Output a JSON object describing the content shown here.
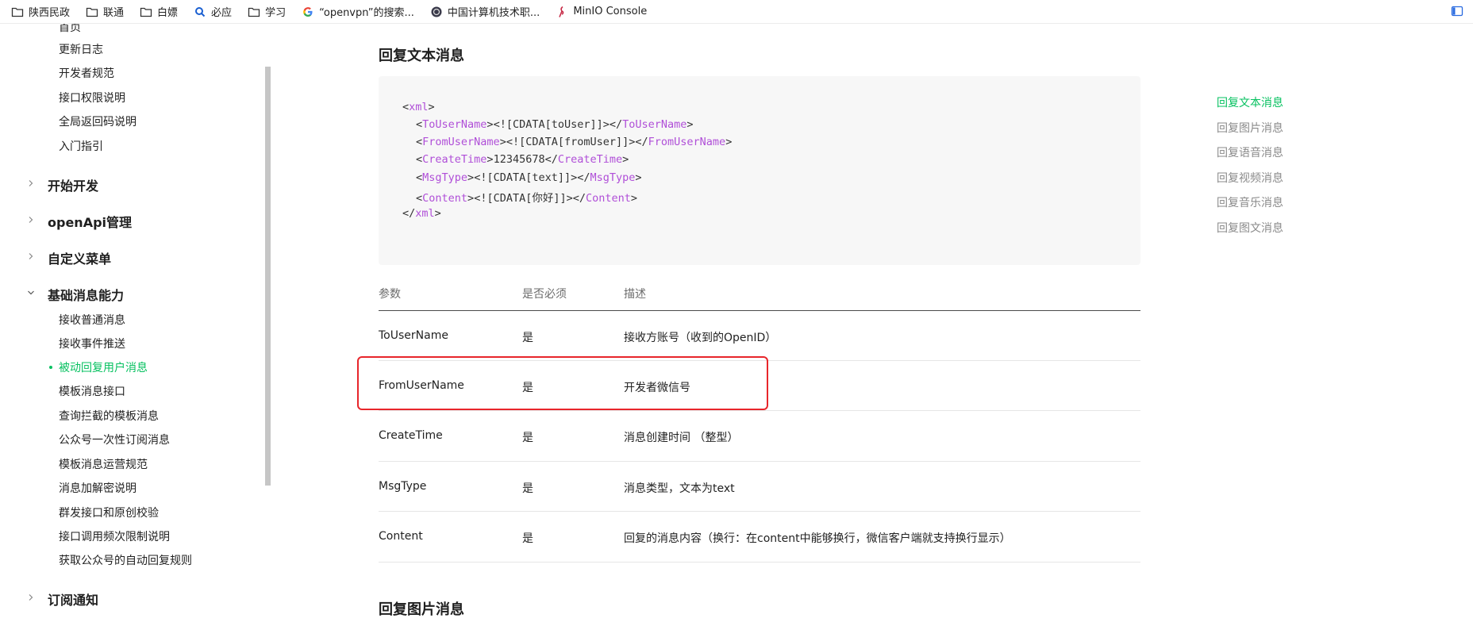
{
  "bookmarks": [
    {
      "label": "陕西民政",
      "icon": "folder-icon"
    },
    {
      "label": "联通",
      "icon": "folder-icon"
    },
    {
      "label": "白嫖",
      "icon": "folder-icon"
    },
    {
      "label": "必应",
      "icon": "search-icon"
    },
    {
      "label": "学习",
      "icon": "folder-icon"
    },
    {
      "label": "“openvpn”的搜索...",
      "icon": "google-icon"
    },
    {
      "label": "中国计算机技术职...",
      "icon": "site-icon"
    },
    {
      "label": "MinIO Console",
      "icon": "minio-icon"
    }
  ],
  "sidebar": {
    "top_items": [
      "首页",
      "更新日志",
      "开发者规范",
      "接口权限说明",
      "全局返回码说明",
      "入门指引"
    ],
    "groups": [
      "开始开发",
      "openApi管理",
      "自定义菜单",
      "基础消息能力",
      "订阅通知"
    ],
    "basic_items": [
      "接收普通消息",
      "接收事件推送",
      "被动回复用户消息",
      "模板消息接口",
      "查询拦截的模板消息",
      "公众号一次性订阅消息",
      "模板消息运营规范",
      "消息加解密说明",
      "群发接口和原创校验",
      "接口调用频次限制说明",
      "获取公众号的自动回复规则"
    ],
    "active_item": "被动回复用户消息"
  },
  "main": {
    "section_title": "回复文本消息",
    "next_section_title": "回复图片消息",
    "code": {
      "open_xml": "xml",
      "lines": [
        {
          "tag": "ToUserName",
          "value": "<![CDATA[toUser]]>"
        },
        {
          "tag": "FromUserName",
          "value": "<![CDATA[fromUser]]>"
        },
        {
          "tag": "CreateTime",
          "value": "12345678"
        },
        {
          "tag": "MsgType",
          "value": "<![CDATA[text]]>"
        },
        {
          "tag": "Content",
          "value": "<![CDATA[你好]]>"
        }
      ]
    },
    "table": {
      "headers": [
        "参数",
        "是否必须",
        "描述"
      ],
      "rows": [
        [
          "ToUserName",
          "是",
          "接收方账号（收到的OpenID）"
        ],
        [
          "FromUserName",
          "是",
          "开发者微信号"
        ],
        [
          "CreateTime",
          "是",
          "消息创建时间 （整型）"
        ],
        [
          "MsgType",
          "是",
          "消息类型，文本为text"
        ],
        [
          "Content",
          "是",
          "回复的消息内容（换行：在content中能够换行，微信客户端就支持换行显示）"
        ]
      ]
    }
  },
  "toc": {
    "items": [
      "回复文本消息",
      "回复图片消息",
      "回复语音消息",
      "回复视频消息",
      "回复音乐消息",
      "回复图文消息"
    ],
    "active": "回复文本消息"
  },
  "colors": {
    "accent": "#07c160",
    "highlight": "#e8262b",
    "xml_tag": "#b04fd8"
  }
}
